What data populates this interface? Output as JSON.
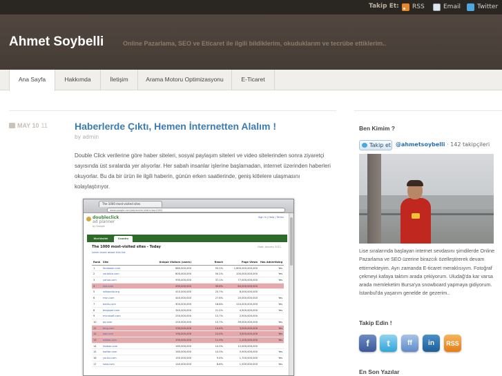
{
  "topbar": {
    "follow_label": "Takip Et:",
    "links": [
      {
        "label": "RSS",
        "icon": "rss-icon"
      },
      {
        "label": "Email",
        "icon": "email-icon"
      },
      {
        "label": "Twitter",
        "icon": "twitter-icon"
      }
    ]
  },
  "header": {
    "site_title": "Ahmet Soybelli",
    "tagline": "Online Pazarlama, SEO ve Eticaret ile ilgili bildiklerim, okuduklarım ve tecrübe ettiklerim.."
  },
  "nav": {
    "items": [
      {
        "label": "Ana Sayfa",
        "active": true
      },
      {
        "label": "Hakkımda",
        "active": false
      },
      {
        "label": "İletişim",
        "active": false
      },
      {
        "label": "Arama Motoru Optimizasyonu",
        "active": false
      },
      {
        "label": "E-Ticaret",
        "active": false
      }
    ]
  },
  "post": {
    "date_day": "MAY 10",
    "date_year": "11",
    "title": "Haberlerde Çıktı, Hemen İnternetten Alalım !",
    "meta": "by admin",
    "body": "Double Click verilerine göre haber siteleri, sosyal paylaşım siteleri ve video sitelerinden sonra ziyaretçi sayısında üst sıralarda yer alıyorlar. Her sabah insanlar işlerine başlamadan, internet üzerinden haberleri okuyorlar. Bu da bir ürün ile ilgili haberin, günün erken saatlerinde, geniş kitlelere ulaşmasını kolaylaştırıyor."
  },
  "screenshot": {
    "tab_title": "The 1000 most-visited sites",
    "url": "www.google.com/adplanner/static/top1000/",
    "logo_line1": "doubleclick",
    "logo_line2": "ad planner",
    "logo_by": "by Google",
    "header_links": "Sign in | Help | Terms",
    "tabs": [
      "Worldwide",
      "Country"
    ],
    "heading": "The 1000 most-visited sites - Today",
    "subheading": "Learn more about this list",
    "date_note": "Data: January 2011",
    "table": {
      "headers": [
        "Rank",
        "Site",
        "Unique Visitors (users)",
        "Reach",
        "Page Views",
        "Has Advertising"
      ],
      "rows": [
        [
          "1",
          "facebook.com",
          "880,000,000",
          "55.2%",
          "1,600,000,000,000",
          "Yes"
        ],
        [
          "2",
          "youtube.com",
          "800,000,000",
          "50.2%",
          "100,000,000,000",
          "Yes"
        ],
        [
          "3",
          "yahoo.com",
          "590,000,000",
          "37.1%",
          "77,000,000,000",
          "Yes"
        ],
        [
          "4",
          "live.com",
          "490,000,000",
          "30.8%",
          "84,000,000,000",
          ""
        ],
        [
          "5",
          "wikipedia.org",
          "410,000,000",
          "25.7%",
          "6,000,000,000",
          ""
        ],
        [
          "6",
          "msn.com",
          "440,000,000",
          "27.6%",
          "20,000,000,000",
          "Yes"
        ],
        [
          "7",
          "baidu.com",
          "300,000,000",
          "18.8%",
          "110,000,000,000",
          "Yes"
        ],
        [
          "8",
          "blogspot.com",
          "340,000,000",
          "21.2%",
          "4,900,000,000",
          "Yes"
        ],
        [
          "9",
          "microsoft.com",
          "250,000,000",
          "15.7%",
          "2,500,000,000",
          ""
        ],
        [
          "10",
          "qq.com",
          "250,000,000",
          "15.7%",
          "39,000,000,000",
          "Yes"
        ],
        [
          "11",
          "bing.com",
          "230,000,000",
          "14.4%",
          "3,000,000,000",
          "Yes"
        ],
        [
          "12",
          "ask.com",
          "190,000,000",
          "12.0%",
          "3,500,000,000",
          "Yes"
        ],
        [
          "13",
          "adobe.com",
          "190,000,000",
          "11.9%",
          "1,100,000,000",
          "Yes"
        ],
        [
          "14",
          "taobao.com",
          "160,000,000",
          "10.0%",
          "12,000,000,000",
          ""
        ],
        [
          "15",
          "twitter.com",
          "160,000,000",
          "10.0%",
          "5,900,000,000",
          "Yes"
        ],
        [
          "16",
          "youku.com",
          "150,000,000",
          "9.4%",
          "1,700,000,000",
          "Yes"
        ],
        [
          "17",
          "soso.com",
          "140,000,000",
          "8.8%",
          "1,500,000,000",
          "Yes"
        ]
      ],
      "highlighted_rows": [
        3,
        10,
        11,
        12
      ]
    }
  },
  "sidebar": {
    "about_heading": "Ben Kimim ?",
    "follow_button": "Takip et",
    "follow_handle": "@ahmetsoybelli",
    "follower_count": "142 takipçileri",
    "bio": "Lise sıralarında başlayan internet sevdasını şimdilerde Online Pazarlama ve SEO üzerine birazcık özelleştirerek devam ettirmekteyim. Ayrı zamanda E-ticaret meraklısıyım. Fotoğraf çekmeyi kafaya taktım arada çekiyorum. Uludağ'da kar varsa arada memleketim Bursa'ya snowboard yapmaya gidiyorum. İstanbul'da yaşarım genelde de gezerim..",
    "follow_us_heading": "Takip Edin !",
    "social": [
      {
        "icon": "facebook-icon",
        "glyph": "f"
      },
      {
        "icon": "twitter-icon",
        "glyph": "t"
      },
      {
        "icon": "friendfeed-icon",
        "glyph": "ff"
      },
      {
        "icon": "linkedin-icon",
        "glyph": "in"
      },
      {
        "icon": "rss-feed-icon",
        "glyph": "RSS"
      }
    ],
    "recent_posts_heading": "En Son Yazılar"
  }
}
